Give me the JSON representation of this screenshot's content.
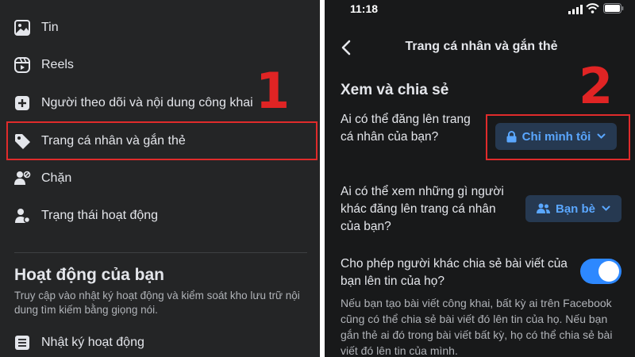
{
  "left_panel": {
    "menu_items": [
      {
        "label": "Tin",
        "icon": "photo-icon"
      },
      {
        "label": "Reels",
        "icon": "reels-icon"
      },
      {
        "label": "Người theo dõi và nội dung công khai",
        "icon": "add-square-icon"
      },
      {
        "label": "Trang cá nhân và gắn thẻ",
        "icon": "tag-icon"
      },
      {
        "label": "Chặn",
        "icon": "block-user-icon"
      },
      {
        "label": "Trạng thái hoạt động",
        "icon": "active-status-icon"
      }
    ],
    "section_title": "Hoạt động của bạn",
    "section_description": "Truy cập vào nhật ký hoạt động và kiểm soát kho lưu trữ nội dung tìm kiếm bằng giọng nói.",
    "activity_log": {
      "label": "Nhật ký hoạt động",
      "icon": "list-icon"
    },
    "annotation_number": "1"
  },
  "right_panel": {
    "status_bar": {
      "time": "11:18"
    },
    "header": {
      "title": "Trang cá nhân và gắn thẻ",
      "back_icon": "chevron-left-icon"
    },
    "section_title": "Xem và chia sẻ",
    "settings": [
      {
        "question": "Ai có thể đăng lên trang cá nhân của bạn?",
        "value": "Chỉ mình tôi",
        "icon": "lock-icon"
      },
      {
        "question": "Ai có thể xem những gì người khác đăng lên trang cá nhân của bạn?",
        "value": "Bạn bè",
        "icon": "friends-icon"
      },
      {
        "question": "Cho phép người khác chia sẻ bài viết của bạn lên tin của họ?",
        "toggle_on": true
      }
    ],
    "share_description": "Nếu bạn tạo bài viết công khai, bất kỳ ai trên Facebook cũng có thể chia sẻ bài viết đó lên tin của họ. Nếu bạn gắn thẻ ai đó trong bài viết bất kỳ, họ có thể chia sẻ bài viết đó lên tin của mình.",
    "annotation_number": "2"
  },
  "colors": {
    "annotation_red": "#e02b2b",
    "accent_blue": "#2d88ff",
    "pill_bg": "#263951",
    "pill_text": "#5aa7ff",
    "left_bg": "#242526",
    "right_bg": "#18191a"
  }
}
